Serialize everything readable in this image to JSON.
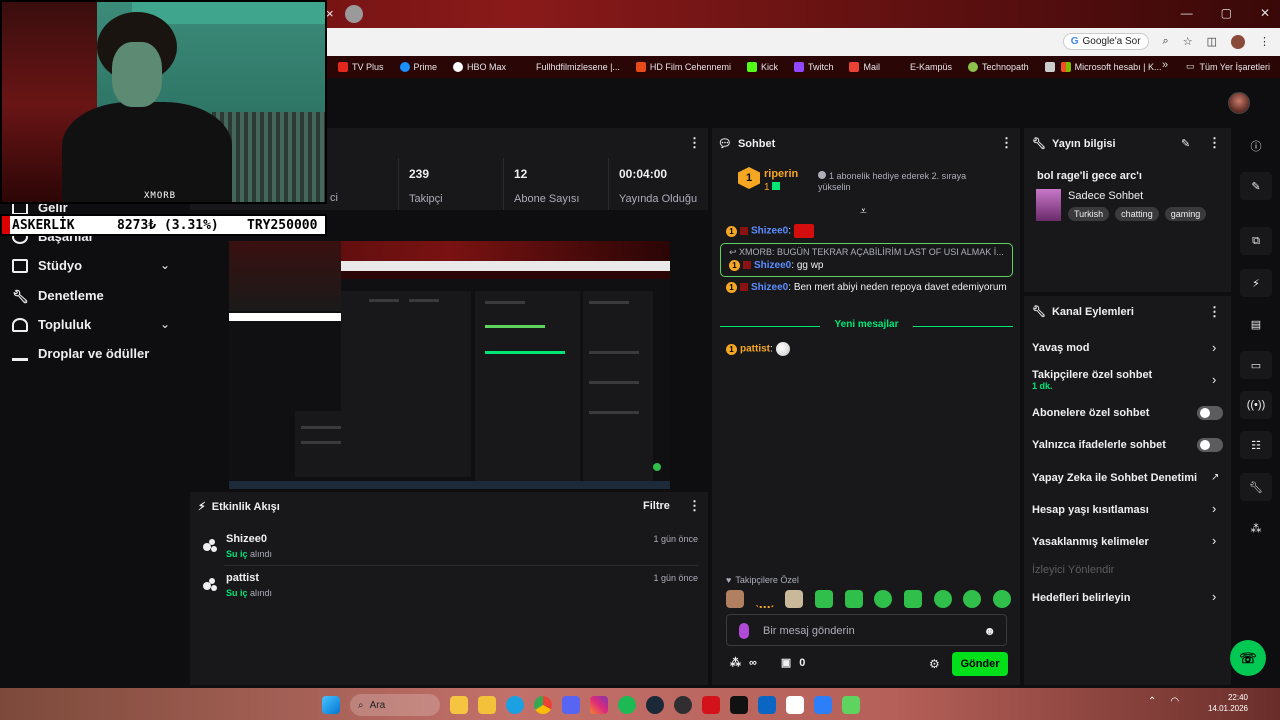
{
  "browser": {
    "tab_close": "×",
    "google_ask": "Google'a Sor",
    "window_controls": [
      "—",
      "▢",
      "✕"
    ],
    "bookmarks": [
      {
        "label": "TV Plus",
        "color": "#e0281e"
      },
      {
        "label": "Prime",
        "color": "#1a8fff"
      },
      {
        "label": "HBO Max",
        "color": "#ffffff"
      },
      {
        "label": "Fullhdfilmizlesene |...",
        "color": "#2b0606"
      },
      {
        "label": "HD Film Cehennemi",
        "color": "#e64a19"
      },
      {
        "label": "Kick",
        "color": "#53fc18"
      },
      {
        "label": "Twitch",
        "color": "#9146ff"
      },
      {
        "label": "Mail",
        "color": "#ea4335"
      },
      {
        "label": "E-Kampüs",
        "color": "#2b0606"
      },
      {
        "label": "Technopath",
        "color": "#8bc34a"
      },
      {
        "label": "",
        "color": "#cccccc"
      },
      {
        "label": "Microsoft hesabı | K...",
        "color": "#f25022"
      }
    ],
    "bookmarks_more": "»",
    "all_bookmarks": "Tüm Yer İşaretleri"
  },
  "overlay": {
    "webcam_label": "XMORB",
    "ticker_left": "ASKERLİK",
    "ticker_mid": "8273₺ (3.31%)",
    "ticker_right": "TRY250000"
  },
  "leftnav": {
    "items": [
      {
        "label": "Gelir",
        "icon": "revenue-icon"
      },
      {
        "label": "Başarılar",
        "icon": "achievements-icon"
      },
      {
        "label": "Stüdyo",
        "icon": "studio-icon",
        "expandable": true
      },
      {
        "label": "Denetleme",
        "icon": "wrench-icon"
      },
      {
        "label": "Topluluk",
        "icon": "community-icon",
        "expandable": true
      },
      {
        "label": "Droplar ve ödüller",
        "icon": "drops-icon"
      }
    ]
  },
  "stats": [
    {
      "value": "239",
      "label": "Takipçi"
    },
    {
      "value": "12",
      "label": "Abone Sayısı"
    },
    {
      "value": "00:04:00",
      "label": "Yayında Olduğu"
    }
  ],
  "stats_partial_label": "ci",
  "activity": {
    "title": "Etkinlik Akışı",
    "filter": "Filtre",
    "items": [
      {
        "user": "Shizee0",
        "reward": "Su iç",
        "suffix": "alındı",
        "time": "1 gün önce"
      },
      {
        "user": "pattist",
        "reward": "Su iç",
        "suffix": "alındı",
        "time": "1 gün önce"
      }
    ]
  },
  "chat": {
    "title": "Sohbet",
    "hype": {
      "rank": "1",
      "user": "riperin",
      "count": "1",
      "text": "1 abonelik hediye ederek 2. sıraya yükselin"
    },
    "messages": [
      {
        "user": "Shizee0",
        "text": ""
      },
      {
        "reply_to": "XMORB: BUGÜN TEKRAR AÇABİLİRİM LAST OF USI ALMAK İ...",
        "user": "Shizee0",
        "text": "gg wp"
      },
      {
        "user": "Shizee0",
        "text": "Ben mert abiyi neden repoya davet edemiyorum"
      }
    ],
    "new_messages": "Yeni mesajlar",
    "new_msg": {
      "user": "pattist",
      "text": ""
    },
    "followers_only": "Takipçilere Özel",
    "input_placeholder": "Bir mesaj gönderin",
    "points": "∞",
    "bits": "0",
    "send": "Gönder"
  },
  "stream_info": {
    "title": "Yayın bilgisi",
    "stream_title": "bol rage'li gece arc'ı",
    "category": "Sadece Sohbet",
    "tags": [
      "Turkish",
      "chatting",
      "gaming"
    ]
  },
  "channel_actions": {
    "title": "Kanal Eylemleri",
    "items": [
      {
        "label": "Yavaş mod",
        "kind": "chevron"
      },
      {
        "label": "Takipçilere özel sohbet",
        "sub": "1 dk.",
        "kind": "chevron"
      },
      {
        "label": "Abonelere özel sohbet",
        "kind": "toggle"
      },
      {
        "label": "Yalnızca ifadelerle sohbet",
        "kind": "toggle"
      },
      {
        "label": "Yapay Zeka ile Sohbet Denetimi",
        "kind": "external"
      },
      {
        "label": "Hesap yaşı kısıtlaması",
        "kind": "chevron"
      },
      {
        "label": "Yasaklanmış kelimeler",
        "kind": "chevron"
      }
    ],
    "disabled_item": "İzleyici Yönlendir",
    "last_item": "Hedefleri belirleyin"
  },
  "taskbar": {
    "search": "Ara",
    "time": "22:40",
    "date": "14.01.2026"
  },
  "colors": {
    "accent_green": "#00e01a",
    "hype_gold": "#f5a623",
    "username_blue": "#5c8dff"
  }
}
